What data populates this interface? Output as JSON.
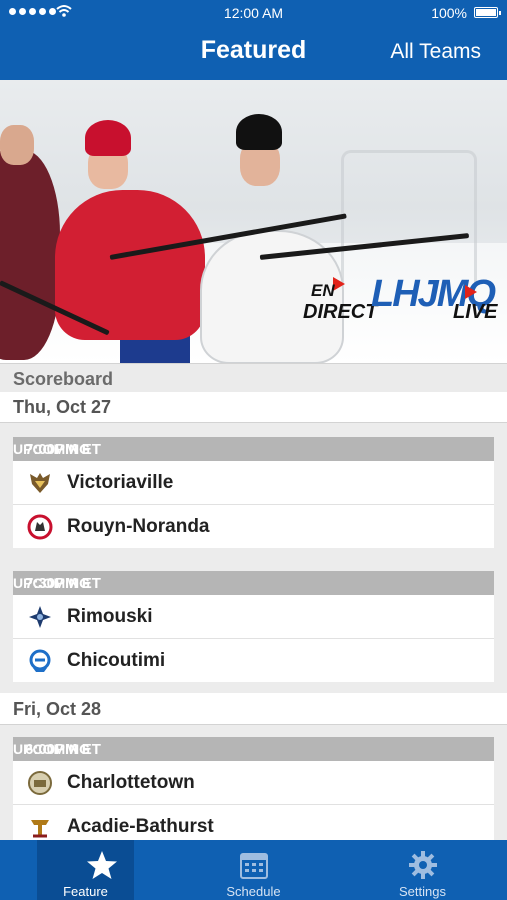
{
  "status_bar": {
    "time": "12:00 AM",
    "battery": "100%"
  },
  "nav": {
    "title": "Featured",
    "right_button": "All Teams"
  },
  "banner": {
    "logo_en": "EN",
    "logo_direct": "DIRECT",
    "logo_mark": "LHJMQ",
    "logo_live": "LIVE"
  },
  "scoreboard": {
    "title": "Scoreboard",
    "days": [
      {
        "date": "Thu, Oct 27",
        "games": [
          {
            "time": "7:00PM ET",
            "status": "UPCOMING",
            "teams": [
              {
                "name": "Victoriaville",
                "icon": "tigres-logo",
                "color": "#7a5a2a"
              },
              {
                "name": "Rouyn-Noranda",
                "icon": "huskies-logo",
                "color": "#c8102e"
              }
            ]
          },
          {
            "time": "7:30PM ET",
            "status": "UPCOMING",
            "teams": [
              {
                "name": "Rimouski",
                "icon": "oceanic-logo",
                "color": "#1d3b6e"
              },
              {
                "name": "Chicoutimi",
                "icon": "sagueneens-logo",
                "color": "#1e6fc8"
              }
            ]
          }
        ]
      },
      {
        "date": "Fri, Oct 28",
        "games": [
          {
            "time": "6:00PM ET",
            "status": "UPCOMING",
            "teams": [
              {
                "name": "Charlottetown",
                "icon": "islanders-logo",
                "color": "#7b6a3c"
              },
              {
                "name": "Acadie-Bathurst",
                "icon": "titan-logo",
                "color": "#b07a18"
              }
            ]
          }
        ]
      }
    ]
  },
  "tabs": [
    {
      "label": "Feature",
      "icon": "star-icon",
      "active": true
    },
    {
      "label": "Schedule",
      "icon": "calendar-icon",
      "active": false
    },
    {
      "label": "Settings",
      "icon": "gear-icon",
      "active": false
    }
  ],
  "colors": {
    "brand_blue": "#0f60b2",
    "game_header_gray": "#b5b5b5",
    "accent_red": "#e2231a"
  }
}
